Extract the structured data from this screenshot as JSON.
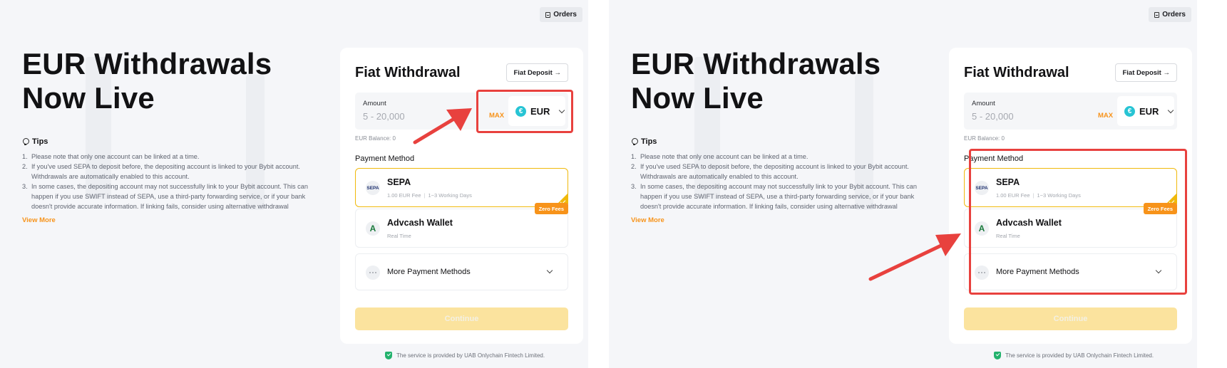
{
  "header": {
    "orders_label": "Orders"
  },
  "hero": {
    "line1": "EUR Withdrawals",
    "line2": "Now Live"
  },
  "tips": {
    "title": "Tips",
    "items": [
      "Please note that only one account can be linked at a time.",
      "If you've used SEPA to deposit before, the depositing account is linked to your Bybit account. Withdrawals are automatically enabled to this account.",
      "In some cases, the depositing account may not successfully link to your Bybit account. This can happen if you use SWIFT instead of SEPA, use a third-party forwarding service, or if your bank doesn't provide accurate information. If linking fails, consider using alternative withdrawal"
    ],
    "view_more": "View More"
  },
  "card": {
    "title": "Fiat Withdrawal",
    "deposit_label": "Fiat Deposit →",
    "amount": {
      "label": "Amount",
      "placeholder": "5 - 20,000",
      "max_label": "MAX",
      "currency": "EUR",
      "currency_symbol": "€"
    },
    "balance": "EUR Balance: 0",
    "payment_method_label": "Payment Method",
    "options": [
      {
        "name": "SEPA",
        "icon": "SEPA",
        "fee": "1.00 EUR Fee",
        "time": "1~3 Working Days",
        "selected": true
      },
      {
        "name": "Advcash Wallet",
        "icon": "A",
        "sub": "Real Time",
        "badge": "Zero Fees"
      }
    ],
    "more_methods": "More Payment Methods",
    "continue_label": "Continue"
  },
  "footer": {
    "service": "The service is provided by UAB Onlychain Fintech Limited."
  },
  "colors": {
    "accent": "#f7931a",
    "highlight": "#e8413e",
    "selected_border": "#f0b90b",
    "continue_bg": "#fbe39e"
  }
}
